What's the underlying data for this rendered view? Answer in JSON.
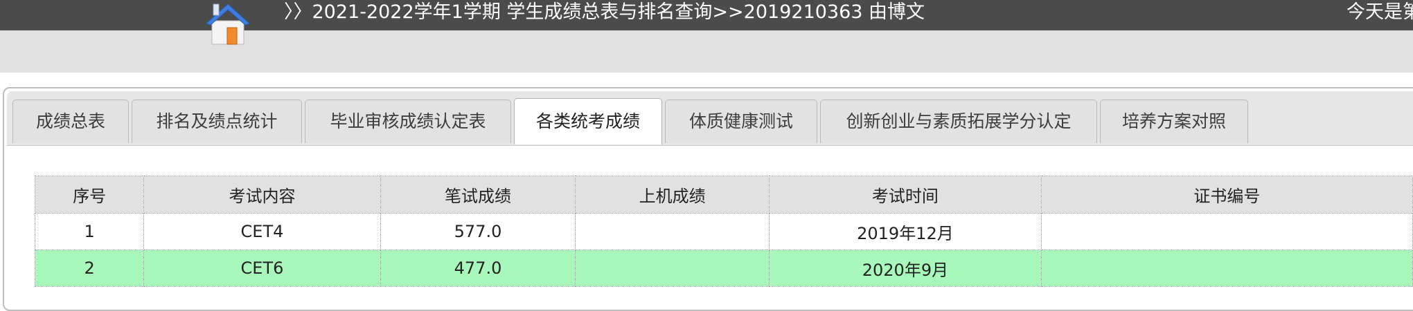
{
  "header": {
    "breadcrumb": "〉〉2021-2022学年1学期 学生成绩总表与排名查询>>2019210363 由博文",
    "today": "今天是第"
  },
  "tabs": [
    {
      "label": "成绩总表"
    },
    {
      "label": "排名及绩点统计"
    },
    {
      "label": "毕业审核成绩认定表"
    },
    {
      "label": "各类统考成绩",
      "active": true
    },
    {
      "label": "体质健康测试"
    },
    {
      "label": "创新创业与素质拓展学分认定"
    },
    {
      "label": "培养方案对照"
    }
  ],
  "table": {
    "headers": [
      "序号",
      "考试内容",
      "笔试成绩",
      "上机成绩",
      "考试时间",
      "证书编号"
    ],
    "rows": [
      [
        "1",
        "CET4",
        "577.0",
        "",
        "2019年12月",
        ""
      ],
      [
        "2",
        "CET6",
        "477.0",
        "",
        "2020年9月",
        ""
      ]
    ]
  },
  "colors": {
    "topbar": "#4b4b4b",
    "band": "#e1e1e1",
    "highlight_row": "#a9f8bb"
  }
}
